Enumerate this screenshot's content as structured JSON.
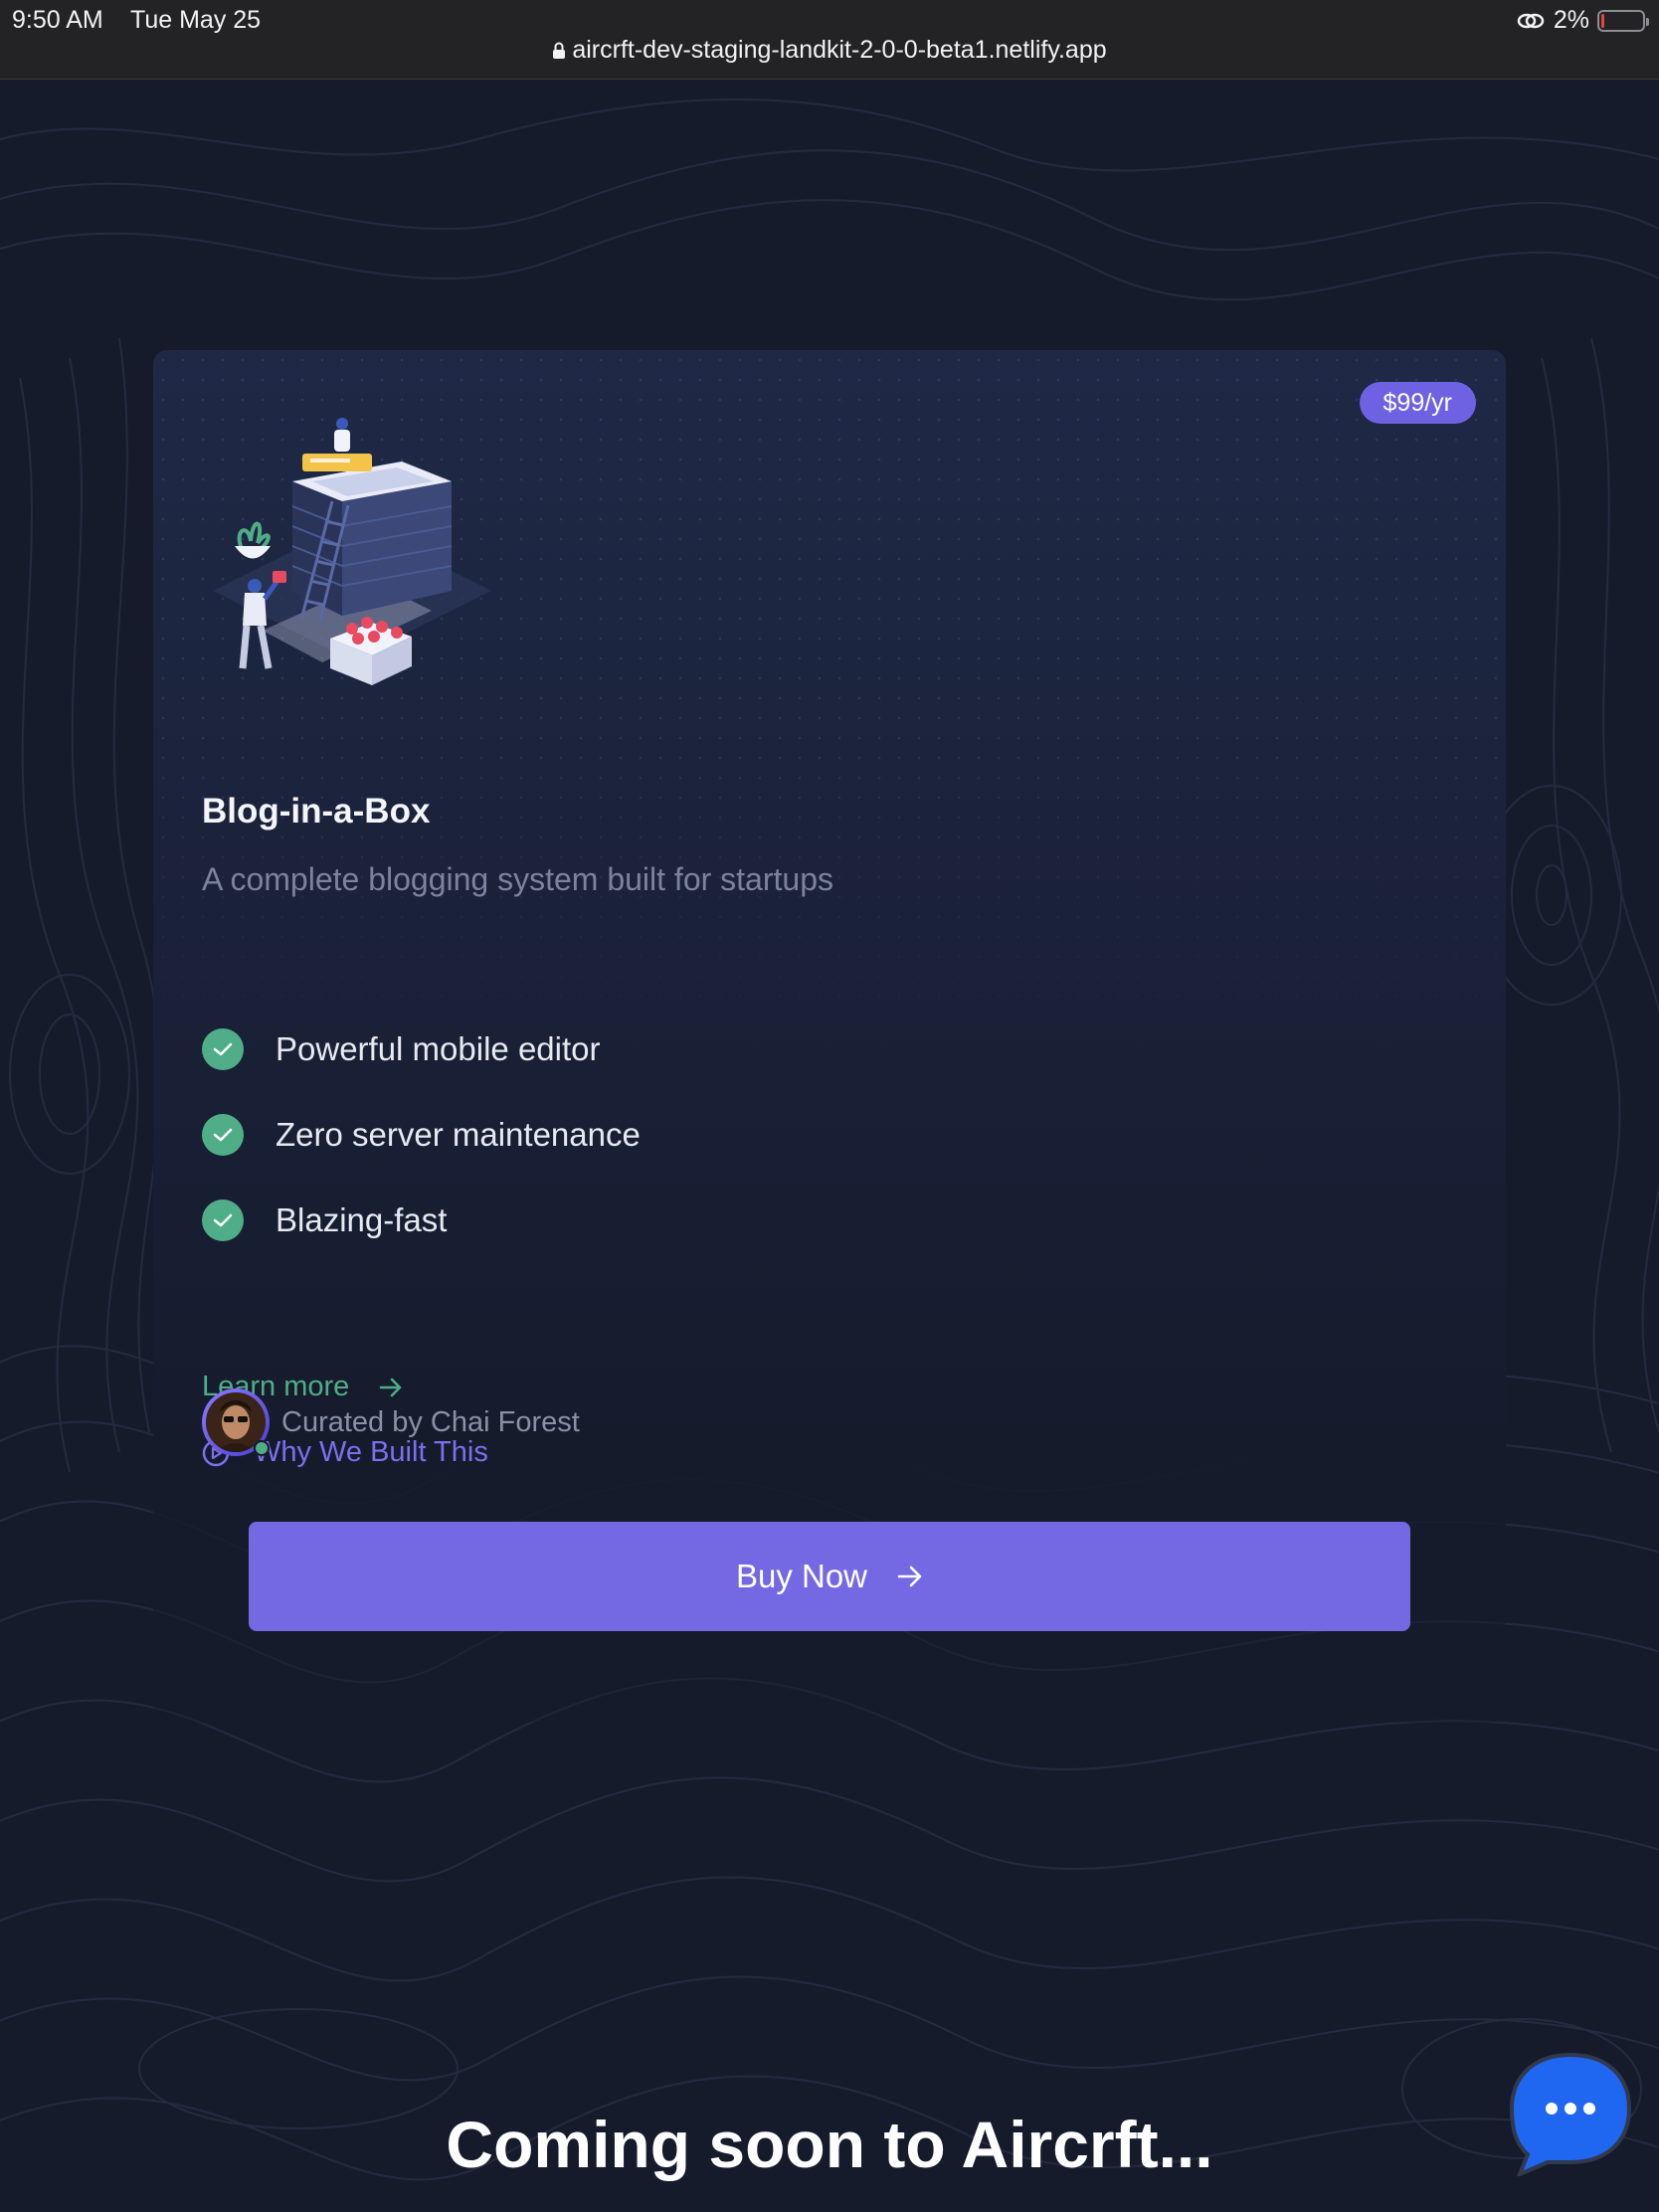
{
  "status_bar": {
    "time": "9:50 AM",
    "date": "Tue May 25",
    "battery_percent": "2%",
    "url": "aircrft-dev-staging-landkit-2-0-0-beta1.netlify.app"
  },
  "card": {
    "price": "$99/yr",
    "title": "Blog-in-a-Box",
    "subtitle": "A complete blogging system built for startups",
    "features": [
      "Powerful mobile editor",
      "Zero server maintenance",
      "Blazing-fast"
    ],
    "learn_more": "Learn more",
    "why_built": "Why We Built This",
    "curator": "Curated by Chai Forest",
    "buy_button": "Buy Now"
  },
  "footer": {
    "coming_soon": "Coming soon to Aircrft..."
  },
  "colors": {
    "accent_purple": "#7569e3",
    "accent_green": "#4fae87",
    "background": "#161b2c"
  },
  "icons": [
    "lock-icon",
    "link-icon",
    "battery-icon",
    "check-icon",
    "arrow-right-icon",
    "play-circle-icon",
    "chat-bubble-icon"
  ]
}
